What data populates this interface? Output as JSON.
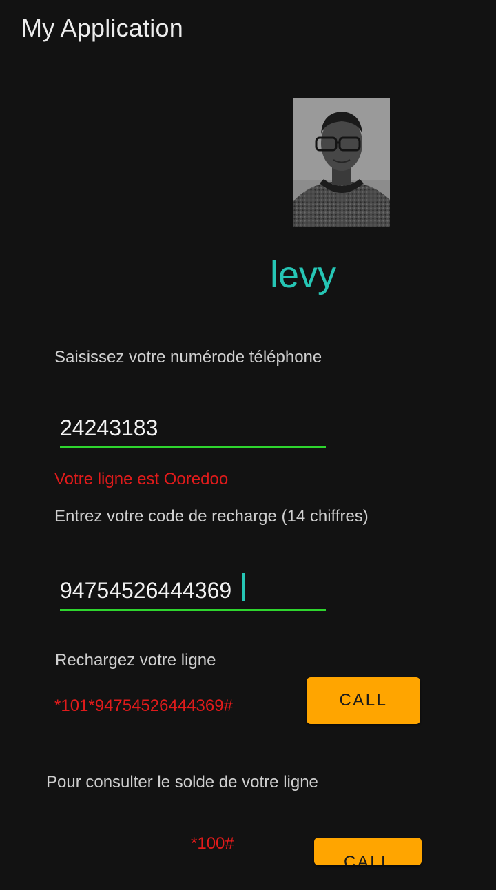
{
  "app": {
    "title": "My Application"
  },
  "profile": {
    "photo_icon": "profile-photo",
    "username": "levy"
  },
  "phone_section": {
    "label": "Saisissez votre numérode téléphone",
    "value": "24243183",
    "operator_message": "Votre ligne est Ooredoo"
  },
  "recharge_code_section": {
    "label": "Entrez votre code de recharge (14 chiffres)",
    "value": "94754526444369"
  },
  "recharge_section": {
    "label": "Rechargez votre ligne",
    "ussd_code": "*101*94754526444369#",
    "call_label": "CALL"
  },
  "balance_section": {
    "label": "Pour consulter le solde de votre ligne",
    "ussd_code": "*100#",
    "call_label": "CALL"
  },
  "colors": {
    "background": "#121212",
    "accent": "#26c6b5",
    "field_underline": "#2ed52e",
    "error_text": "#e01b1b",
    "button": "#ffa500"
  }
}
